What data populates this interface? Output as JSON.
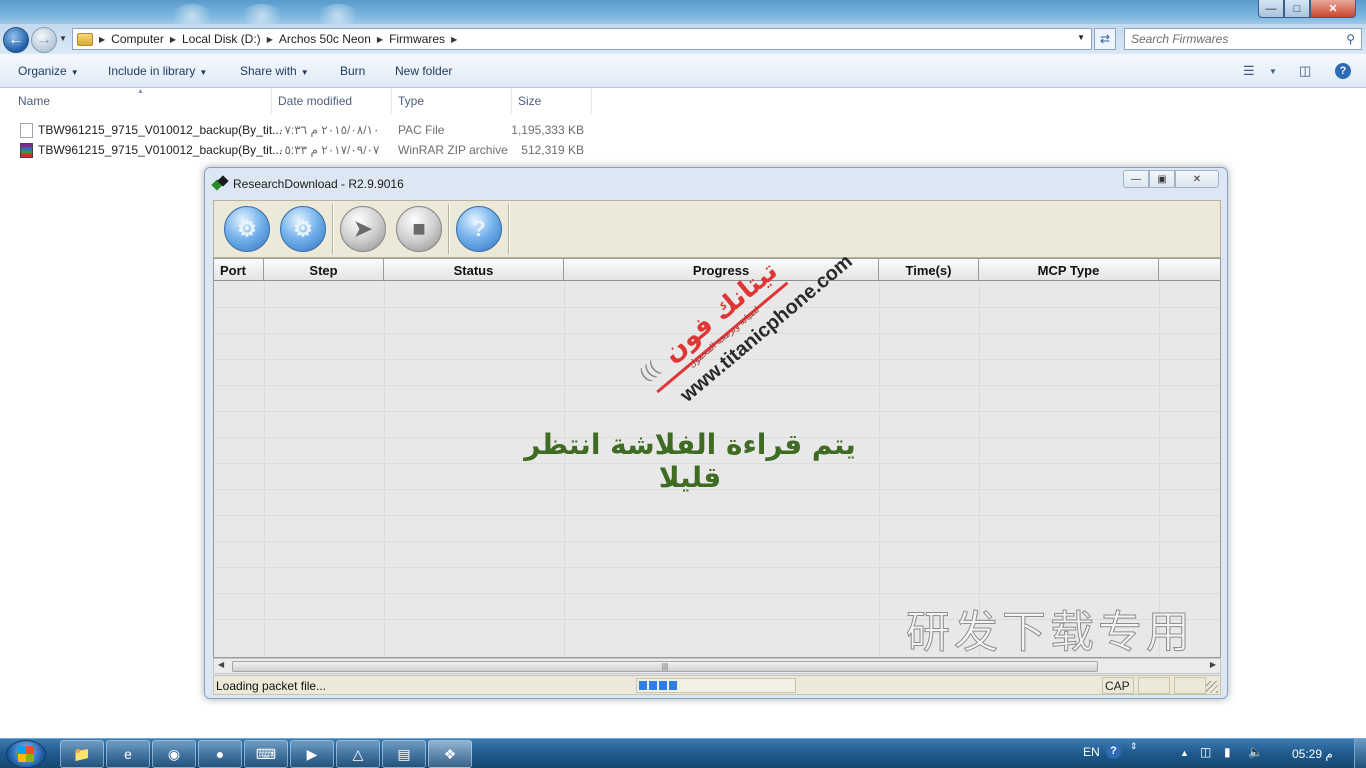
{
  "explorer": {
    "breadcrumb": [
      "Computer",
      "Local Disk (D:)",
      "Archos 50c Neon",
      "Firmwares"
    ],
    "search_placeholder": "Search Firmwares",
    "commands": {
      "organize": "Organize",
      "include_in_library": "Include in library",
      "share_with": "Share with",
      "burn": "Burn",
      "new_folder": "New folder"
    },
    "columns": {
      "name": "Name",
      "date_modified": "Date modified",
      "type": "Type",
      "size": "Size"
    },
    "files": [
      {
        "name": "TBW961215_9715_V010012_backup(By_tit...",
        "date": "٢٠١٥/٠٨/١٠ م ٠٧:٣٦",
        "type": "PAC File",
        "size": "1,195,333 KB",
        "icon": "pac-file-icon"
      },
      {
        "name": "TBW961215_9715_V010012_backup(By_tit...",
        "date": "٢٠١٧/٠٩/٠٧ م ٠٥:٣٣",
        "type": "WinRAR ZIP archive",
        "size": "512,319 KB",
        "icon": "winrar-archive-icon"
      }
    ]
  },
  "research_download": {
    "title": "ResearchDownload - R2.9.9016",
    "toolbar_icons": [
      "load-packet-icon",
      "settings-icon",
      "start-icon",
      "stop-icon",
      "help-icon"
    ],
    "grid_columns": [
      "Port",
      "Step",
      "Status",
      "Progress",
      "Time(s)",
      "MCP Type"
    ],
    "status_text": "Loading packet file...",
    "progress_fraction": 0.25,
    "cap_indicator": "CAP"
  },
  "overlay": {
    "arabic_message": "يتم قراءة الفلاشة انتظر قليلا",
    "logo_arabic": "تيتانك فون",
    "logo_subtitle": "لصيانة وبرمجة المحمول",
    "logo_url": "www.titanicphone.com",
    "chinese_watermark": "研发下载专用"
  },
  "taskbar": {
    "language": "EN",
    "clock": "05:29 م",
    "pinned": [
      "explorer-icon",
      "ie-icon",
      "chrome-icon",
      "firefox-icon",
      "keyboard-app-icon",
      "media-player-icon",
      "vlc-icon",
      "notepad-icon",
      "researchdownload-icon"
    ]
  },
  "colors": {
    "accent": "#2f73c4",
    "arabic_text": "#3f6b22",
    "logo_red": "#e03535"
  }
}
